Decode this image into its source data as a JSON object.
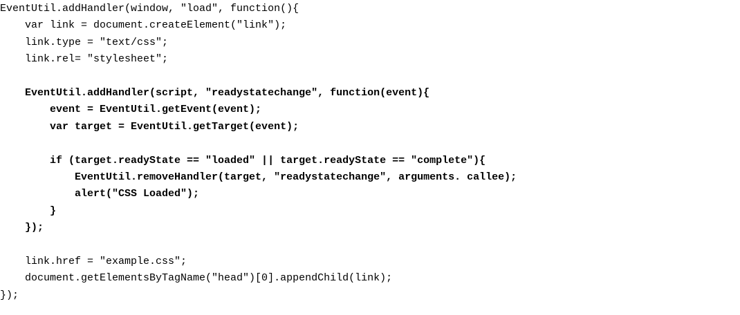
{
  "code": {
    "lines": [
      {
        "text": "EventUtil.addHandler(window, \"load\", function(){",
        "bold": false
      },
      {
        "text": "    var link = document.createElement(\"link\");",
        "bold": false
      },
      {
        "text": "    link.type = \"text/css\";",
        "bold": false
      },
      {
        "text": "    link.rel= \"stylesheet\";",
        "bold": false
      },
      {
        "text": "",
        "bold": false
      },
      {
        "text": "    EventUtil.addHandler(script, \"readystatechange\", function(event){",
        "bold": true
      },
      {
        "text": "        event = EventUtil.getEvent(event);",
        "bold": true
      },
      {
        "text": "        var target = EventUtil.getTarget(event);",
        "bold": true
      },
      {
        "text": "",
        "bold": true
      },
      {
        "text": "        if (target.readyState == \"loaded\" || target.readyState == \"complete\"){",
        "bold": true
      },
      {
        "text": "            EventUtil.removeHandler(target, \"readystatechange\", arguments. callee);",
        "bold": true
      },
      {
        "text": "            alert(\"CSS Loaded\");",
        "bold": true
      },
      {
        "text": "        }",
        "bold": true
      },
      {
        "text": "    });",
        "bold": true
      },
      {
        "text": "",
        "bold": false
      },
      {
        "text": "    link.href = \"example.css\";",
        "bold": false
      },
      {
        "text": "    document.getElementsByTagName(\"head\")[0].appendChild(link);",
        "bold": false
      },
      {
        "text": "});",
        "bold": false
      }
    ]
  }
}
